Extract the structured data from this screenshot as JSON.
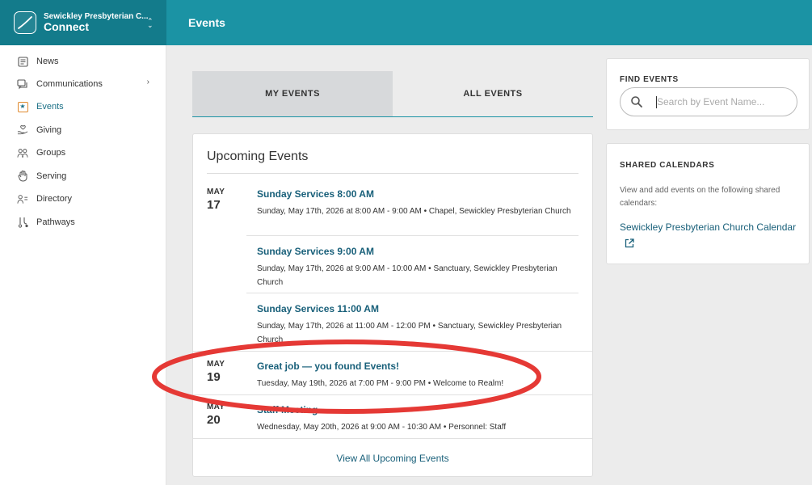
{
  "header": {
    "org_name": "Sewickley Presbyterian C...",
    "app_name": "Connect",
    "page_title": "Events"
  },
  "sidebar": {
    "items": [
      {
        "label": "News",
        "icon": "news-icon"
      },
      {
        "label": "Communications",
        "icon": "chat-icon",
        "has_submenu": true
      },
      {
        "label": "Events",
        "icon": "star-calendar-icon",
        "active": true
      },
      {
        "label": "Giving",
        "icon": "giving-hand-heart-icon"
      },
      {
        "label": "Groups",
        "icon": "groups-people-icon"
      },
      {
        "label": "Serving",
        "icon": "hand-icon"
      },
      {
        "label": "Directory",
        "icon": "directory-person-icon"
      },
      {
        "label": "Pathways",
        "icon": "pathways-icon"
      }
    ]
  },
  "tabs": {
    "my_events": "MY EVENTS",
    "all_events": "ALL EVENTS",
    "selected": "MY EVENTS"
  },
  "upcoming": {
    "title": "Upcoming Events",
    "dates": [
      {
        "month": "MAY",
        "day": "17"
      },
      {
        "month": "MAY",
        "day": "19"
      },
      {
        "month": "MAY",
        "day": "20"
      }
    ],
    "events": [
      {
        "name": "Sunday Services 8:00 AM",
        "detail": "Sunday, May 17th, 2026 at 8:00 AM - 9:00 AM • Chapel, Sewickley Presbyterian Church"
      },
      {
        "name": "Sunday Services 9:00 AM",
        "detail": "Sunday, May 17th, 2026 at 9:00 AM - 10:00 AM • Sanctuary, Sewickley Presbyterian Church"
      },
      {
        "name": "Sunday Services 11:00 AM",
        "detail": "Sunday, May 17th, 2026 at 11:00 AM - 12:00 PM • Sanctuary, Sewickley Presbyterian Church"
      },
      {
        "name": "Great job — you found Events!",
        "detail": "Tuesday, May 19th, 2026 at 7:00 PM - 9:00 PM • Welcome to Realm!"
      },
      {
        "name": "Staff Meeting",
        "detail": "Wednesday, May 20th, 2026 at 9:00 AM - 10:30 AM • Personnel: Staff"
      }
    ],
    "view_all": "View All Upcoming Events"
  },
  "find_events": {
    "title": "FIND EVENTS",
    "placeholder": "Search by Event Name..."
  },
  "shared_calendars": {
    "title": "SHARED CALENDARS",
    "description": "View and add events on the following shared calendars:",
    "link": "Sewickley Presbyterian Church Calendar"
  },
  "colors": {
    "header_bg": "#1b93a4",
    "org_bg": "#137b8b",
    "link": "#19607a",
    "annotation": "#e53935"
  }
}
